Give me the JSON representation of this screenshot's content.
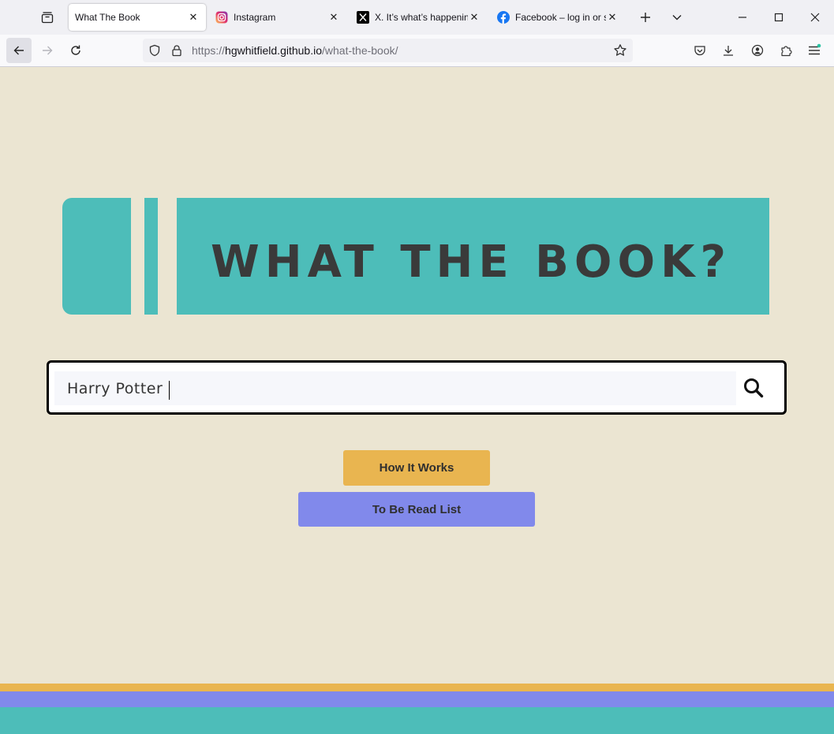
{
  "browser": {
    "tabs": [
      {
        "title": "What The Book",
        "icon": "none",
        "active": true
      },
      {
        "title": "Instagram",
        "icon": "instagram-icon",
        "active": false
      },
      {
        "title": "X. It’s what’s happening",
        "icon": "x-icon",
        "active": false
      },
      {
        "title": "Facebook – log in or sign",
        "icon": "facebook-icon",
        "active": false
      }
    ],
    "url": {
      "scheme": "https://",
      "host": "hgwhitfield.github.io",
      "path": "/what-the-book/"
    }
  },
  "page": {
    "logo_text": "WHAT THE BOOK?",
    "search": {
      "value": "Harry Potter",
      "placeholder": ""
    },
    "buttons": {
      "how_it_works": "How It Works",
      "tbr_list": "To Be Read List"
    }
  },
  "colors": {
    "background": "#ebe5d2",
    "teal": "#4dbdb9",
    "yellow": "#e9b550",
    "periwinkle": "#8189eb",
    "text_dark": "#3a3a3a"
  }
}
